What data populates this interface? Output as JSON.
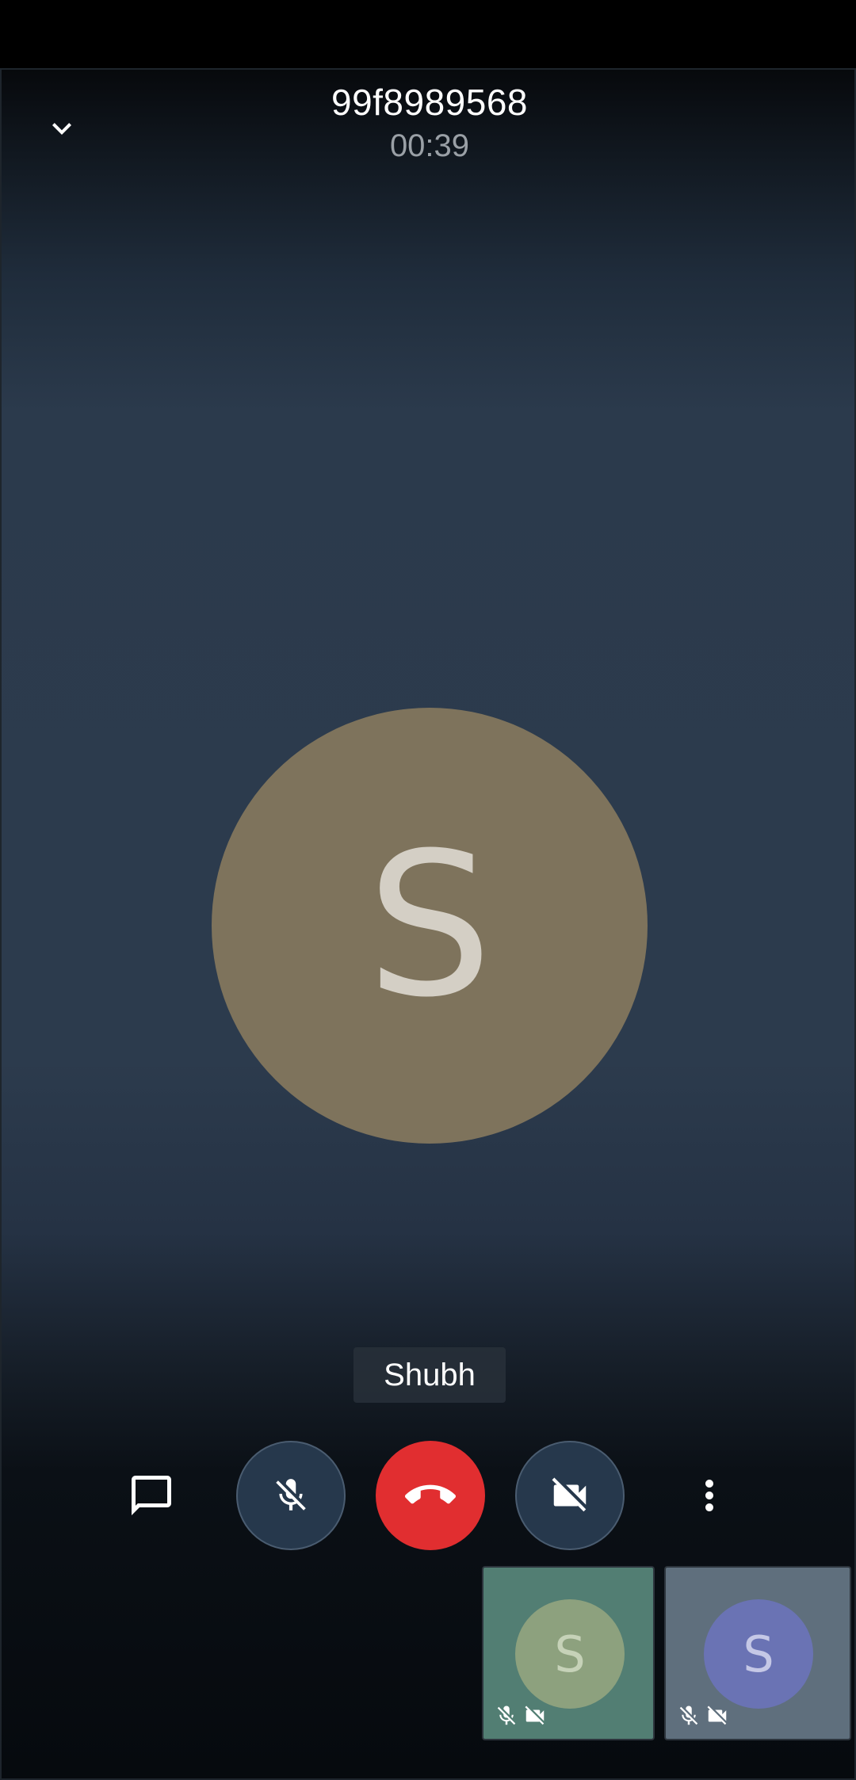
{
  "call": {
    "title": "99f8989568",
    "timer": "00:39",
    "main_participant": {
      "initial": "S",
      "name": "Shubh",
      "avatar_color": "#7e735c"
    }
  },
  "controls": [
    {
      "name": "chat-button",
      "icon": "chat-bubble-icon"
    },
    {
      "name": "mute-button",
      "icon": "mic-off-icon",
      "state": "muted"
    },
    {
      "name": "end-call-button",
      "icon": "call-end-icon",
      "color": "#e12e30"
    },
    {
      "name": "camera-button",
      "icon": "videocam-off-icon",
      "state": "off"
    },
    {
      "name": "more-options-button",
      "icon": "more-vert-icon"
    }
  ],
  "tiles": [
    {
      "initial": "S",
      "tile_color": "#527e73",
      "avatar_color": "#8da17e",
      "icons": [
        "mic-off-icon",
        "videocam-off-icon"
      ]
    },
    {
      "initial": "S",
      "tile_color": "#5f6f7d",
      "avatar_color": "#6a73b4",
      "icons": [
        "mic-off-icon",
        "videocam-off-icon"
      ]
    }
  ]
}
